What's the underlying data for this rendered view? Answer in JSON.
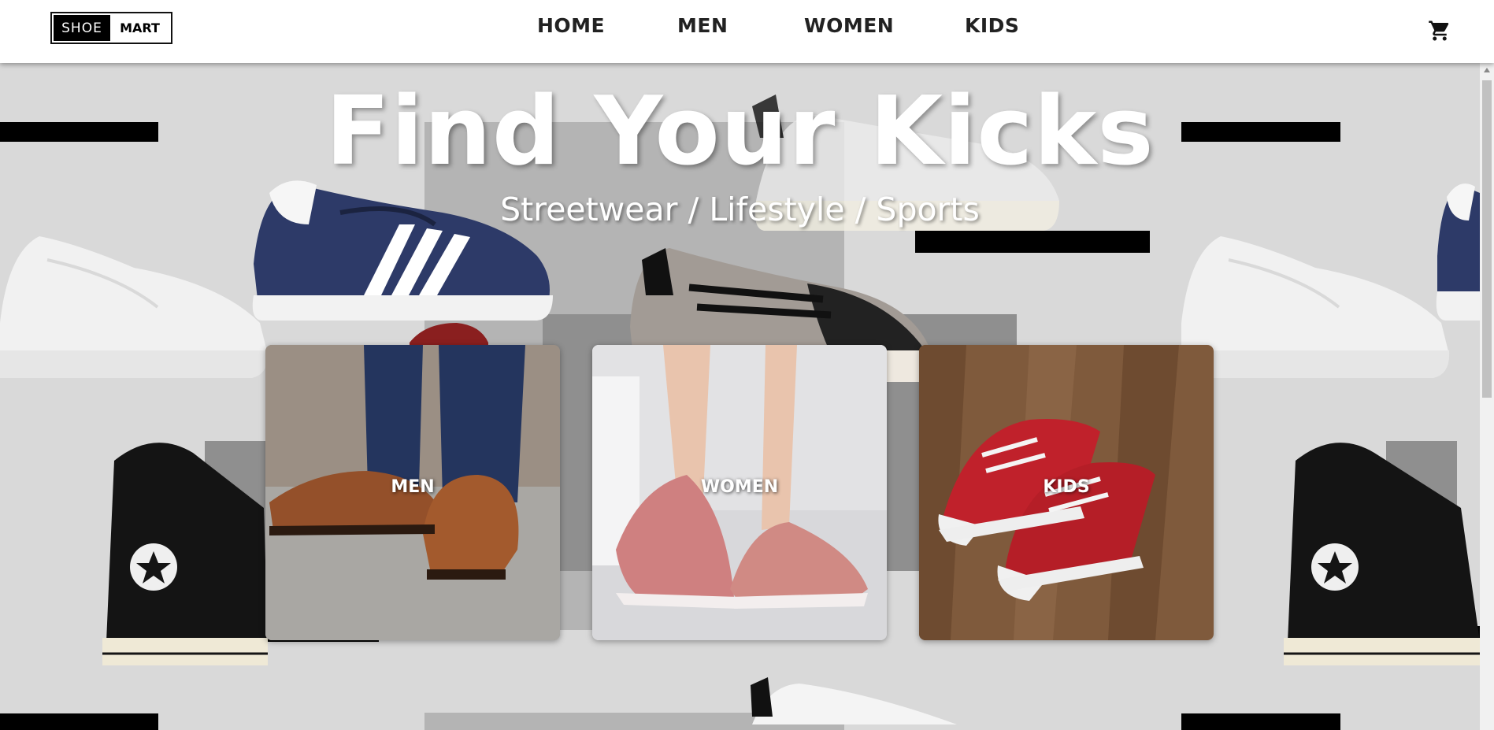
{
  "brand": {
    "logo_left": "SHOE",
    "logo_right": "MART"
  },
  "nav": {
    "items": [
      "HOME",
      "MEN",
      "WOMEN",
      "KIDS"
    ]
  },
  "icons": {
    "cart": "cart-icon"
  },
  "hero": {
    "title": "Find Your Kicks",
    "subtitle": "Streetwear / Lifestyle / Sports"
  },
  "categories": [
    {
      "label": "MEN"
    },
    {
      "label": "WOMEN"
    },
    {
      "label": "KIDS"
    }
  ],
  "colors": {
    "header_bg": "#ffffff",
    "page_bg": "#d9d9d9",
    "accent_black": "#000000",
    "text": "#222222"
  }
}
